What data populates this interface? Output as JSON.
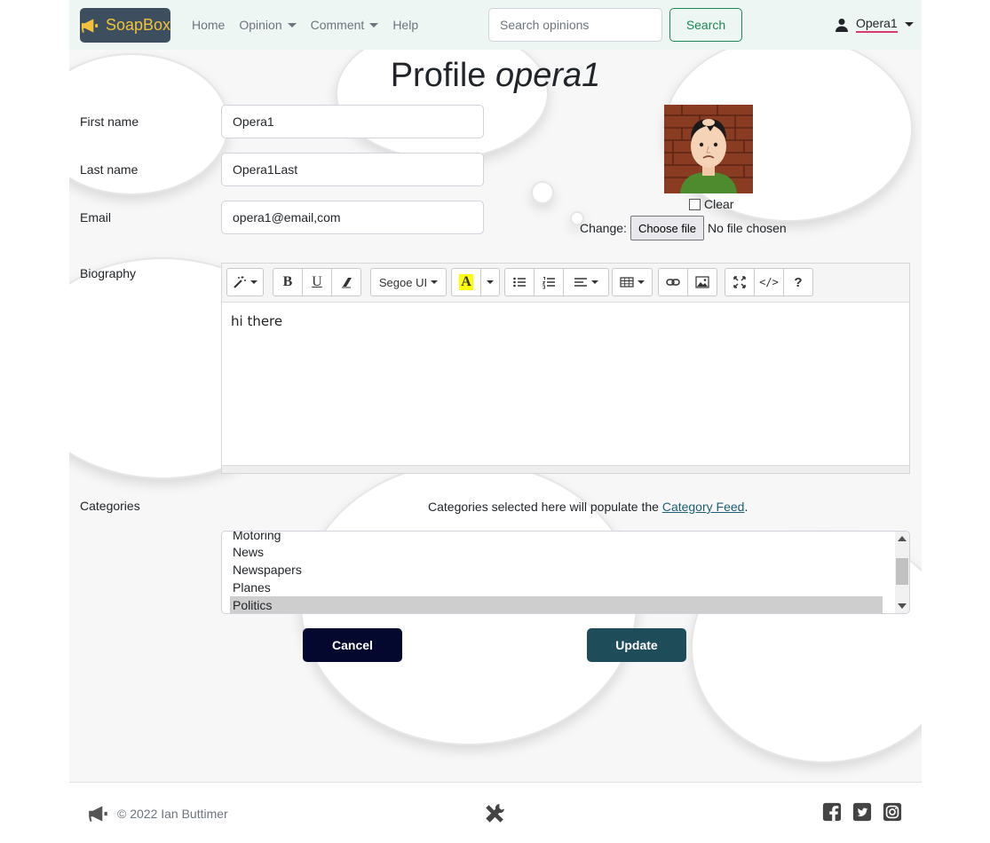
{
  "navbar": {
    "brand": "SoapBox",
    "links": [
      {
        "label": "Home",
        "dropdown": false
      },
      {
        "label": "Opinion",
        "dropdown": true
      },
      {
        "label": "Comment",
        "dropdown": true
      },
      {
        "label": "Help",
        "dropdown": false
      }
    ],
    "search_placeholder": "Search opinions",
    "search_button": "Search",
    "user": "Opera1"
  },
  "page": {
    "title_prefix": "Profile",
    "title_username": "opera1"
  },
  "form": {
    "first_name_label": "First name",
    "first_name_value": "Opera1",
    "last_name_label": "Last name",
    "last_name_value": "Opera1Last",
    "email_label": "Email",
    "email_value": "opera1@email,com",
    "biography_label": "Biography",
    "biography_text": "hi there",
    "avatar": {
      "clear_label": "Clear",
      "change_label": "Change:",
      "choose_file_button": "Choose file",
      "file_status": "No file chosen"
    },
    "editor_toolbar": {
      "font_name": "Segoe UI"
    },
    "categories_label": "Categories",
    "categories_note_before": "Categories selected here will populate the",
    "categories_note_link": "Category Feed",
    "categories_note_after": ".",
    "categories": [
      {
        "label": "Motoring",
        "selected": false
      },
      {
        "label": "News",
        "selected": false
      },
      {
        "label": "Newspapers",
        "selected": false
      },
      {
        "label": "Planes",
        "selected": false
      },
      {
        "label": "Politics",
        "selected": true
      }
    ],
    "cancel_button": "Cancel",
    "update_button": "Update"
  },
  "footer": {
    "copyright": "© 2022 Ian Buttimer",
    "social": [
      "facebook-icon",
      "twitter-icon",
      "instagram-icon"
    ]
  },
  "colors": {
    "brand_bg": "#3d4f5f",
    "brand_text": "#f3c13a",
    "search_green": "#198754",
    "cancel_bg": "#05082e",
    "update_bg": "#1f4c59",
    "navbar_bg": "#eef6f4"
  }
}
